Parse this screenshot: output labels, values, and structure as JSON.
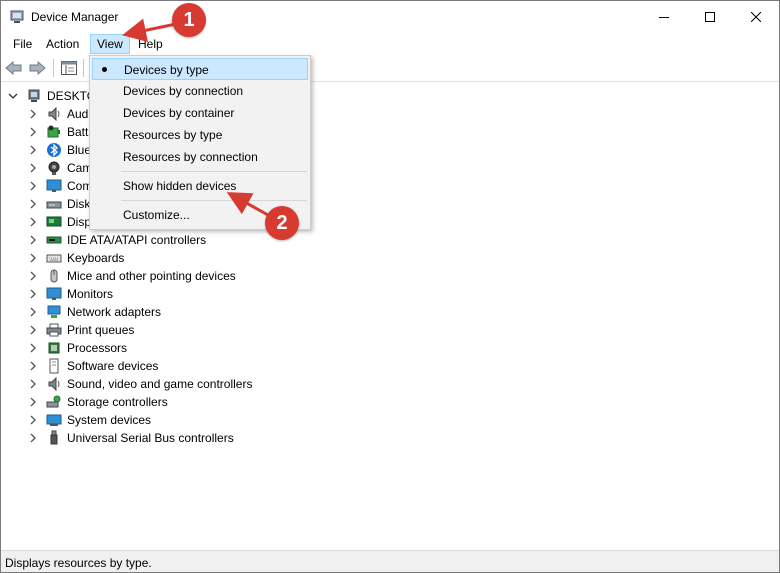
{
  "window": {
    "title": "Device Manager"
  },
  "menubar": {
    "items": [
      "File",
      "Action",
      "View",
      "Help"
    ],
    "active": "View"
  },
  "tree": {
    "root": "DESKTO",
    "items": [
      {
        "label": "Aud",
        "icon": "speaker-icon"
      },
      {
        "label": "Batt",
        "icon": "battery-icon"
      },
      {
        "label": "Blue",
        "icon": "bluetooth-icon"
      },
      {
        "label": "Cam",
        "icon": "camera-icon"
      },
      {
        "label": "Com",
        "icon": "monitor-icon"
      },
      {
        "label": "Disk",
        "icon": "disk-drive-icon"
      },
      {
        "label": "Disp",
        "icon": "display-adapter-icon"
      },
      {
        "label": "IDE ATA/ATAPI controllers",
        "icon": "ide-controller-icon"
      },
      {
        "label": "Keyboards",
        "icon": "keyboard-icon"
      },
      {
        "label": "Mice and other pointing devices",
        "icon": "mouse-icon"
      },
      {
        "label": "Monitors",
        "icon": "monitor-icon"
      },
      {
        "label": "Network adapters",
        "icon": "network-icon"
      },
      {
        "label": "Print queues",
        "icon": "printer-icon"
      },
      {
        "label": "Processors",
        "icon": "processor-icon"
      },
      {
        "label": "Software devices",
        "icon": "software-device-icon"
      },
      {
        "label": "Sound, video and game controllers",
        "icon": "speaker-icon"
      },
      {
        "label": "Storage controllers",
        "icon": "storage-controller-icon"
      },
      {
        "label": "System devices",
        "icon": "system-device-icon"
      },
      {
        "label": "Universal Serial Bus controllers",
        "icon": "usb-icon"
      }
    ]
  },
  "view_menu": {
    "items": [
      {
        "label": "Devices by type",
        "checked": true
      },
      {
        "label": "Devices by connection",
        "checked": false
      },
      {
        "label": "Devices by container",
        "checked": false
      },
      {
        "label": "Resources by type",
        "checked": false
      },
      {
        "label": "Resources by connection",
        "checked": false
      },
      {
        "label": "Show hidden devices",
        "checked": false
      },
      {
        "label": "Customize...",
        "checked": false
      }
    ]
  },
  "statusbar": {
    "text": "Displays resources by type."
  },
  "annotations": {
    "step1": "1",
    "step2": "2",
    "color": "#d63a30"
  },
  "colors": {
    "menu_highlight": "#cce8ff",
    "menu_highlight_border": "#99d1ff"
  }
}
